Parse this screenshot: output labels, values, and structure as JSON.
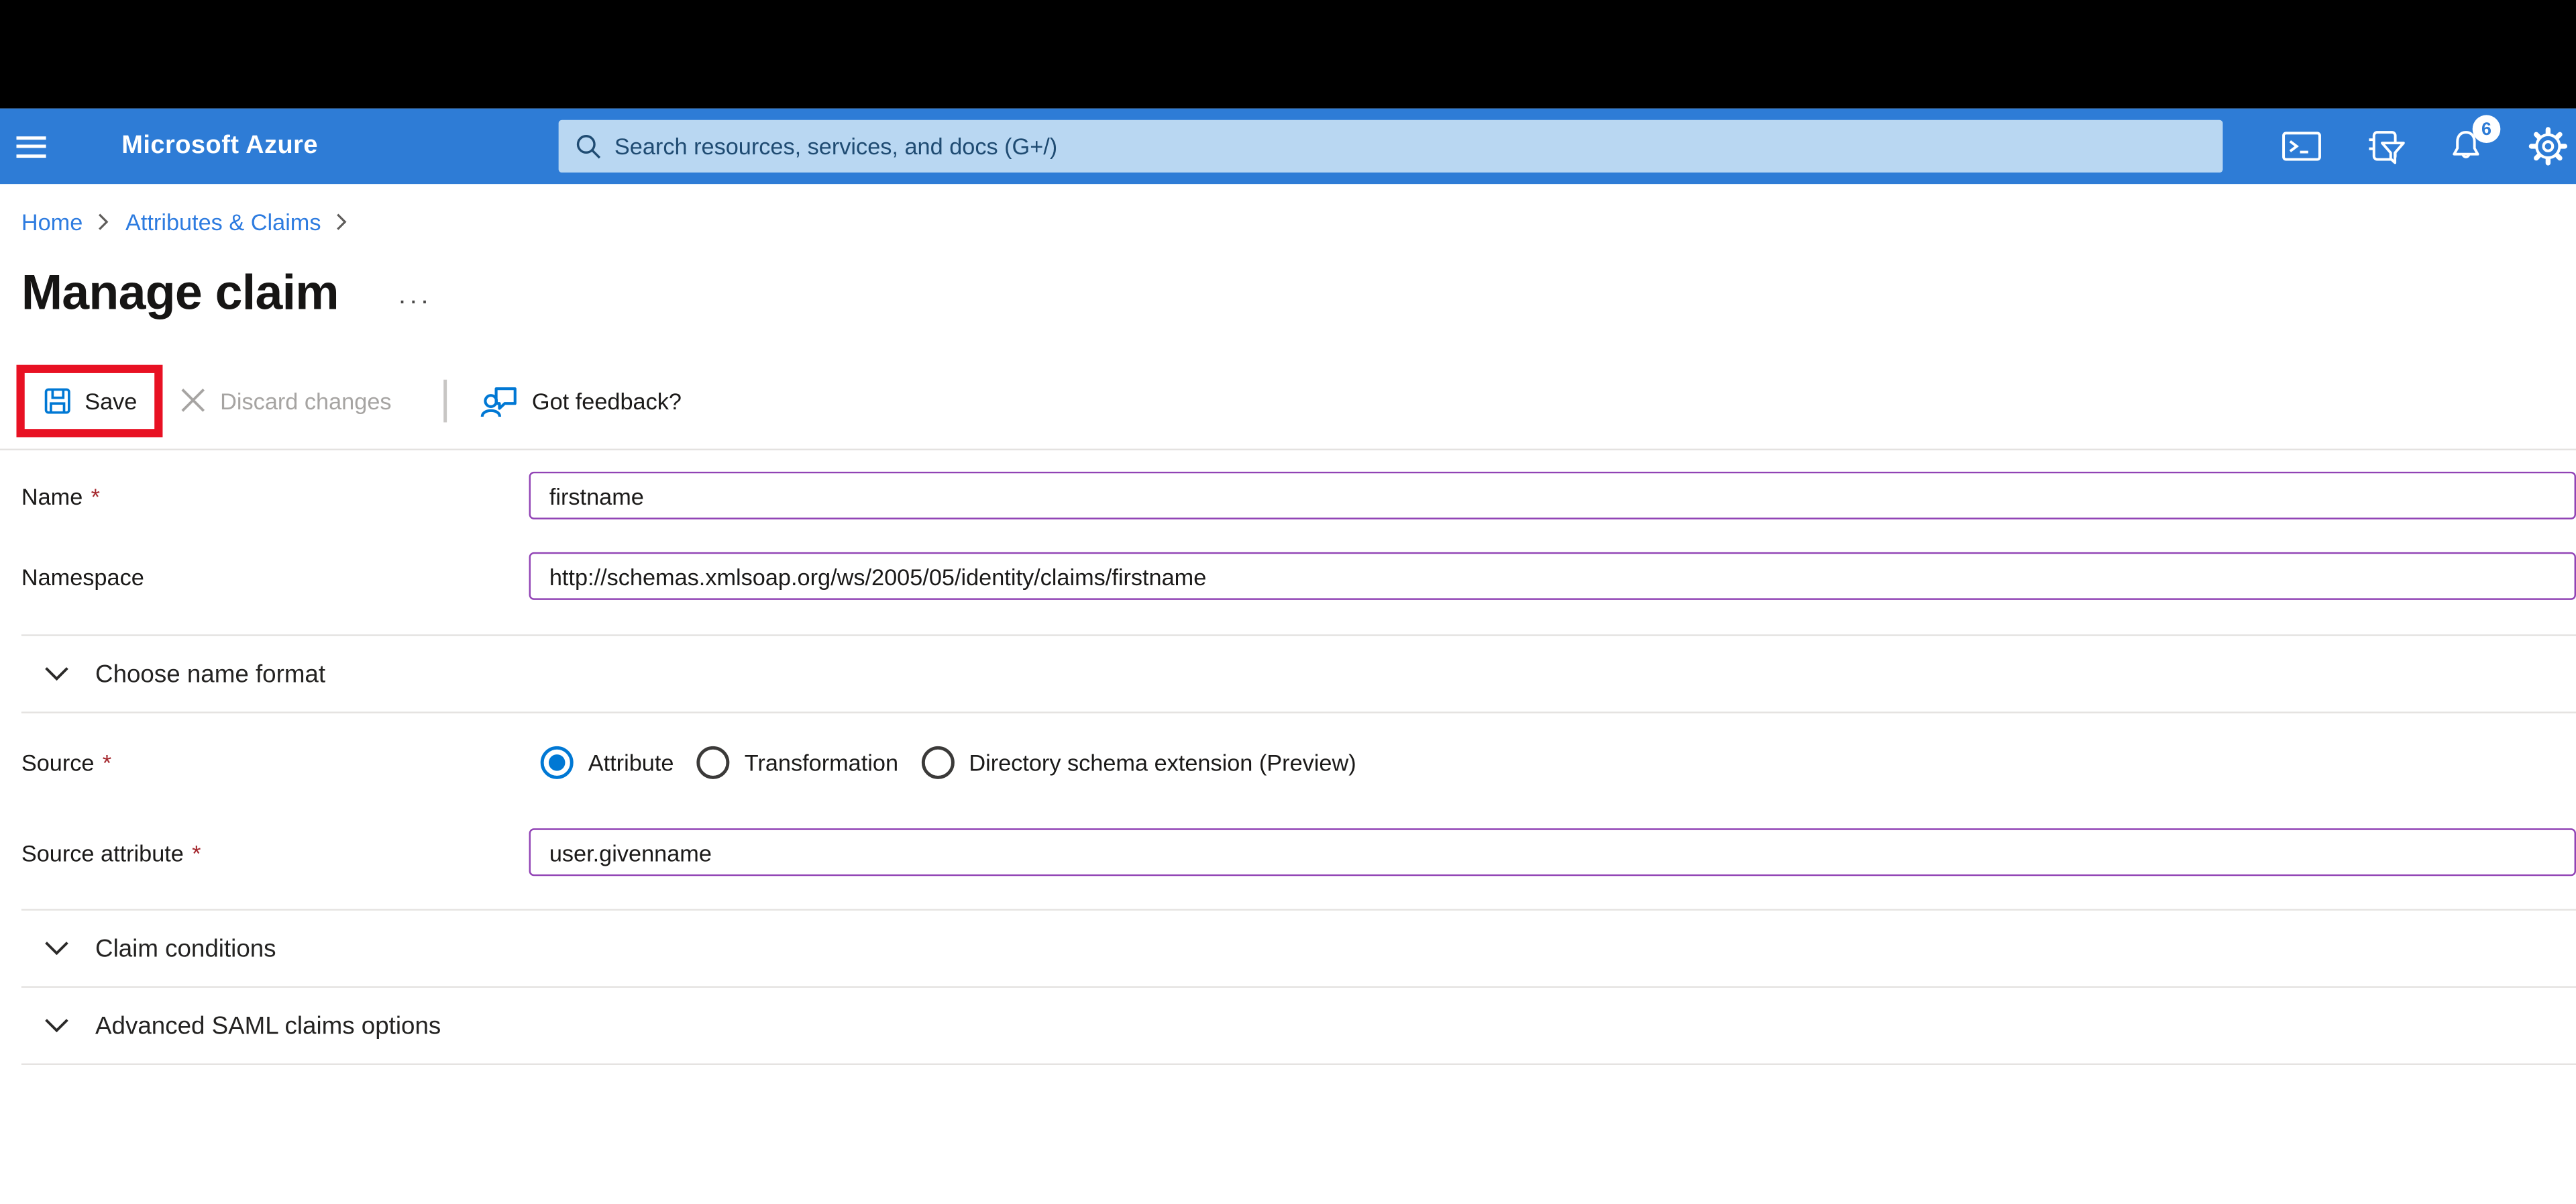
{
  "topbar": {
    "brand": "Microsoft Azure",
    "search_placeholder": "Search resources, services, and docs (G+/)",
    "notification_count": "6"
  },
  "breadcrumb": {
    "items": [
      "Home",
      "Attributes & Claims"
    ]
  },
  "page": {
    "title": "Manage claim",
    "more_label": "···"
  },
  "toolbar": {
    "save_label": "Save",
    "discard_label": "Discard changes",
    "feedback_label": "Got feedback?"
  },
  "ui": {
    "required_marker": "*"
  },
  "form": {
    "name": {
      "label": "Name",
      "required": true,
      "value": "firstname"
    },
    "namespace": {
      "label": "Namespace",
      "required": false,
      "value": "http://schemas.xmlsoap.org/ws/2005/05/identity/claims/firstname"
    },
    "source": {
      "label": "Source",
      "required": true,
      "options": [
        "Attribute",
        "Transformation",
        "Directory schema extension (Preview)"
      ],
      "selected": "Attribute"
    },
    "source_attribute": {
      "label": "Source attribute",
      "required": true,
      "value": "user.givenname"
    },
    "sections": [
      {
        "label": "Choose name format"
      },
      {
        "label": "Claim conditions"
      },
      {
        "label": "Advanced SAML claims options"
      }
    ]
  },
  "icons": {
    "hamburger": "hamburger-icon",
    "search": "search-icon",
    "cloud_shell": "cloud-shell-icon",
    "directory_filter": "directory-filter-icon",
    "notifications": "notifications-bell-icon",
    "settings": "settings-gear-icon",
    "save": "save-floppy-icon",
    "discard": "close-x-icon",
    "feedback": "feedback-person-icon",
    "breadcrumb_separator": "chevron-right-icon",
    "section_expander": "chevron-down-icon",
    "more": "ellipsis-icon"
  },
  "colors": {
    "topbar": "#2e7cd6",
    "accent": "#0078d4",
    "search_bg": "#b9d7f2",
    "link": "#2e7ce0",
    "input_border": "#9143b5",
    "highlight_box": "#e81123",
    "required": "#a4262c",
    "disabled_text": "#a6a4a2"
  }
}
